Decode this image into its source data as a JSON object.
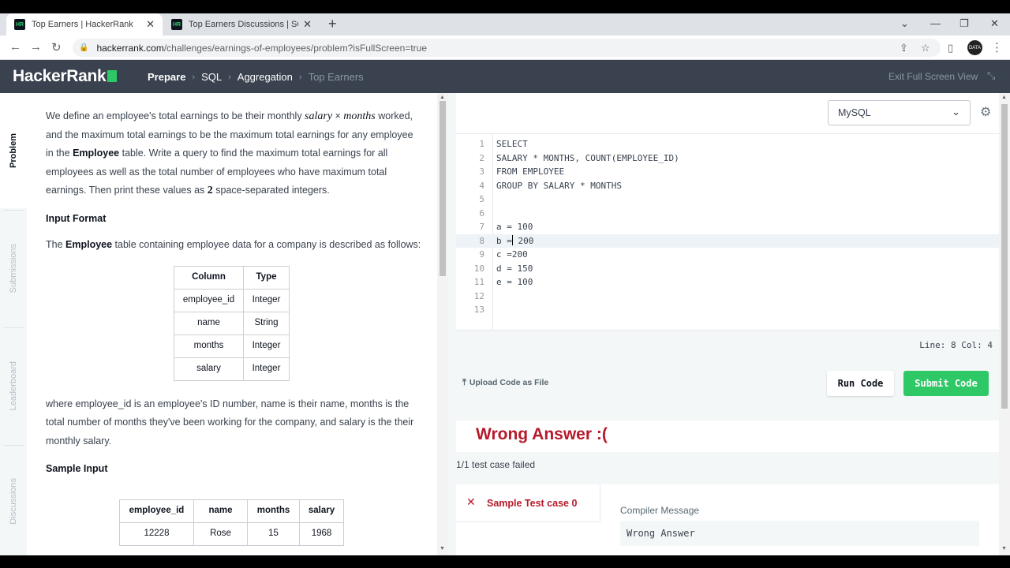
{
  "browser": {
    "tabs": [
      {
        "favicon": "HR",
        "title": "Top Earners | HackerRank",
        "active": true
      },
      {
        "favicon": "HR",
        "title": "Top Earners Discussions | SQL | H",
        "active": false
      }
    ],
    "url_host": "hackerrank.com",
    "url_path": "/challenges/earnings-of-employees/problem?isFullScreen=true",
    "avatar_text": "DATA"
  },
  "header": {
    "logo": "HackerRank",
    "breadcrumb": [
      "Prepare",
      "SQL",
      "Aggregation",
      "Top Earners"
    ],
    "exit_fullscreen": "Exit Full Screen View"
  },
  "side_nav": [
    "Problem",
    "Submissions",
    "Leaderboard",
    "Discussions"
  ],
  "problem": {
    "p1_a": "We define an employee's total earnings to be their monthly ",
    "p1_salary": "salary",
    "p1_times": " × ",
    "p1_months": "months",
    "p1_b": " worked, and the maximum total earnings to be the maximum total earnings for any employee in the ",
    "p1_employee": "Employee",
    "p1_c": " table. Write a query to find the maximum total earnings for all employees as well as the total number of employees who have maximum total earnings. Then print these values as ",
    "p1_two": "2",
    "p1_d": " space-separated integers.",
    "input_format_heading": "Input Format",
    "p2_a": "The ",
    "p2_employee": "Employee",
    "p2_b": " table containing employee data for a company is described as follows:",
    "schema_headers": [
      "Column",
      "Type"
    ],
    "schema_rows": [
      [
        "employee_id",
        "Integer"
      ],
      [
        "name",
        "String"
      ],
      [
        "months",
        "Integer"
      ],
      [
        "salary",
        "Integer"
      ]
    ],
    "p3": "where employee_id is an employee's ID number, name is their name, months is the total number of months they've been working for the company, and salary is the their monthly salary.",
    "sample_input_heading": "Sample Input",
    "sample_headers": [
      "employee_id",
      "name",
      "months",
      "salary"
    ],
    "sample_rows": [
      [
        "12228",
        "Rose",
        "15",
        "1968"
      ]
    ]
  },
  "editor": {
    "language": "MySQL",
    "lines": [
      "SELECT",
      "SALARY * MONTHS, COUNT(EMPLOYEE_ID)",
      "FROM EMPLOYEE",
      "GROUP BY SALARY * MONTHS",
      "",
      "",
      "a = 100",
      "b = 200",
      "c =200",
      "d = 150",
      "e = 100",
      "",
      ""
    ],
    "current_line": 8,
    "status": "Line: 8 Col: 4"
  },
  "actions": {
    "upload": "Upload Code as File",
    "run": "Run Code",
    "submit": "Submit Code"
  },
  "result": {
    "title": "Wrong Answer :(",
    "summary": "1/1 test case failed",
    "test_case": "Sample Test case 0",
    "compiler_label": "Compiler Message",
    "compiler_message": "Wrong Answer"
  },
  "colors": {
    "brand_green": "#2ec866",
    "header_bg": "#39424e",
    "error_red": "#b7192b"
  }
}
